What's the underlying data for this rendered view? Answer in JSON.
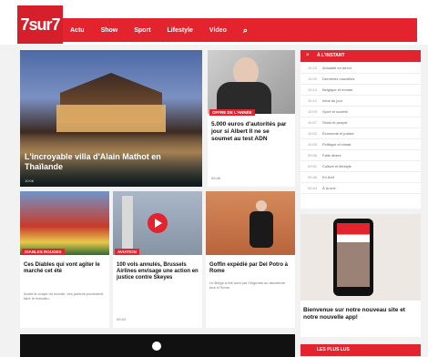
{
  "logo": "7sur7",
  "nav": [
    "Actu",
    "Show",
    "Sport",
    "Lifestyle",
    "Video",
    "⌕"
  ],
  "main_article": {
    "title": "L'incroyable villa d'Alain Mathot en Thaïlande",
    "time": "10:06"
  },
  "top_right_article": {
    "badge": "OFFRE DE L'ANNÉE",
    "title": "5.000 euros d'autorités par jour si Albert II ne se soumet au test ADN",
    "time": "09:46"
  },
  "cards": [
    {
      "badge": "DIABLES ROUGES",
      "title": "Ces Diables qui vont agiter le marché cet été",
      "blurb": "Avant la coupe du monde, ces joueurs pourraient faire le mercato."
    },
    {
      "badge": "AVIATION",
      "title": "100 vols annulés, Brussels Airlines envisage une action en justice contre Skeyes",
      "time": "09:44"
    },
    {
      "badge": "",
      "title": "Goffin expédié par Del Potro à Rome",
      "blurb": "Le Belge a été sorti par l'Argentin au deuxième tour à Rome."
    }
  ],
  "sidebar": {
    "heading": "À L'INSTANT",
    "items": [
      {
        "time": "10:23",
        "text": "Actualité en direct"
      },
      {
        "time": "10:20",
        "text": "Dernières nouvelles"
      },
      {
        "time": "10:14",
        "text": "Belgique et monde"
      },
      {
        "time": "10:12",
        "text": "Infos du jour"
      },
      {
        "time": "10:09",
        "text": "Sport et société"
      },
      {
        "time": "10:07",
        "text": "Show et people"
      },
      {
        "time": "10:02",
        "text": "Économie et justice"
      },
      {
        "time": "10:00",
        "text": "Politique et climat"
      },
      {
        "time": "09:56",
        "text": "Faits divers"
      },
      {
        "time": "09:51",
        "text": "Culture et lifestyle"
      },
      {
        "time": "09:46",
        "text": "En bref"
      },
      {
        "time": "09:44",
        "text": "À la une"
      }
    ],
    "promo_title": "Bienvenue sur notre nouveau site et notre nouvelle app!",
    "bottom_heading": "LES PLUS LUS"
  },
  "colors": {
    "accent": "#e3232d"
  }
}
